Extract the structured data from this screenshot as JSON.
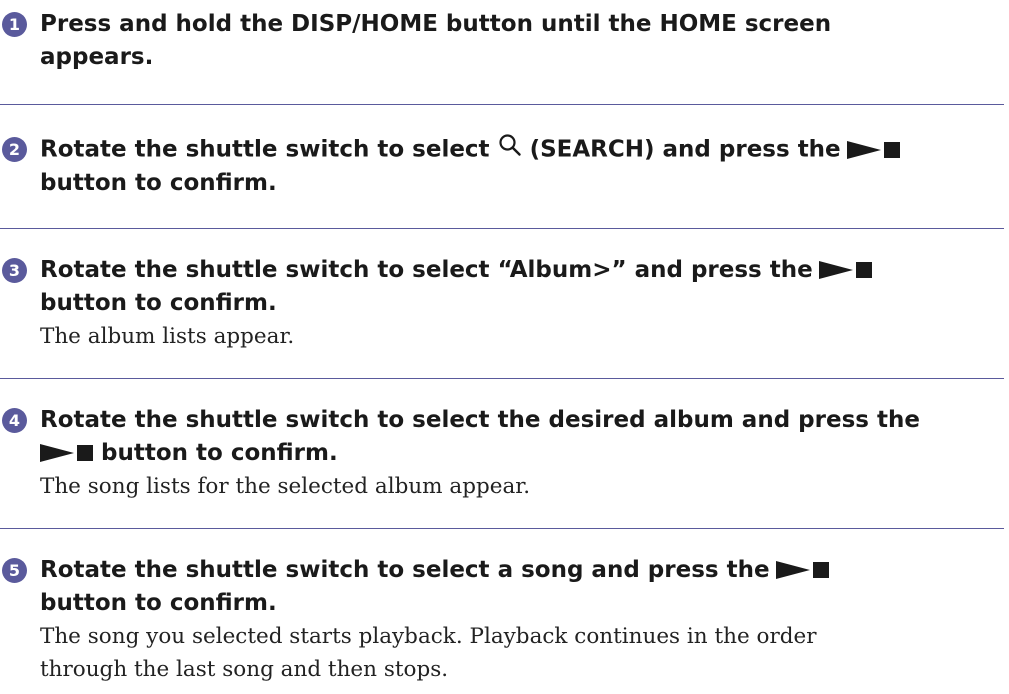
{
  "accent_color": "#5a5a9c",
  "steps": [
    {
      "number": "1",
      "heading_line1": "Press and hold the DISP/HOME button until the HOME screen",
      "heading_line2": "appears."
    },
    {
      "number": "2",
      "heading_part1": "Rotate the shuttle switch to select ",
      "heading_part2": " (SEARCH) and press the",
      "heading_line2": "button to confirm.",
      "icons": [
        "search-icon",
        "play-stop-icon"
      ]
    },
    {
      "number": "3",
      "heading_part1": "Rotate the shuttle switch to select “Album>” and press the",
      "heading_line2": "button to confirm.",
      "body": "The album lists appear.",
      "icons": [
        "play-stop-icon"
      ]
    },
    {
      "number": "4",
      "heading_line1": "Rotate the shuttle switch to select the desired album and press the",
      "heading_line2": " button to confirm.",
      "body": "The song lists for the selected album appear.",
      "icons": [
        "play-stop-icon"
      ]
    },
    {
      "number": "5",
      "heading_part1": "Rotate the shuttle switch to select a song and press the",
      "heading_line2": "button to confirm.",
      "body_line1": "The song you selected starts playback. Playback continues in the order",
      "body_line2": "through the last song and then stops.",
      "icons": [
        "play-stop-icon"
      ]
    }
  ]
}
